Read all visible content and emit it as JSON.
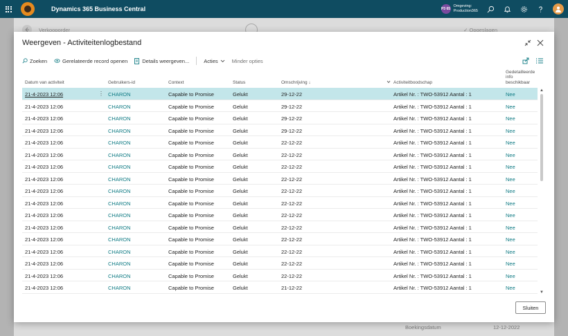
{
  "app": {
    "title": "Dynamics 365 Business Central",
    "environment": {
      "badge": "P3 65",
      "label": "Omgeving:",
      "name": "Production365"
    }
  },
  "background_page": {
    "title": "Verkooporder",
    "saved_status": "✓ Opgeslagen",
    "footer_label": "Boekingsdatum",
    "footer_value": "12-12-2022"
  },
  "dialog": {
    "title": "Weergeven - Activiteitenlogbestand",
    "actions": {
      "search": "Zoeken",
      "open_related": "Gerelateerde record openen",
      "show_details": "Details weergeven...",
      "actions_menu": "Acties",
      "fewer_options": "Minder opties"
    },
    "columns": {
      "date": "Datum van activiteit",
      "user_id": "Gebruikers-id",
      "context": "Context",
      "status": "Status",
      "description": "Omschrijving ↓",
      "message": "Activiteitboodschap",
      "detailed": "Gedetailleerde info beschikbaar"
    },
    "rows": [
      {
        "date": "21-4-2023 12:06",
        "user": "CHARON",
        "context": "Capable to Promise",
        "status": "Gelukt",
        "description": "29-12-22",
        "message": "Artikel Nr. : TWO-53912 Aantal : 1",
        "detailed": "Nee"
      },
      {
        "date": "21-4-2023 12:06",
        "user": "CHARON",
        "context": "Capable to Promise",
        "status": "Gelukt",
        "description": "29-12-22",
        "message": "Artikel Nr. : TWO-53912 Aantal : 1",
        "detailed": "Nee"
      },
      {
        "date": "21-4-2023 12:06",
        "user": "CHARON",
        "context": "Capable to Promise",
        "status": "Gelukt",
        "description": "29-12-22",
        "message": "Artikel Nr. : TWO-53912 Aantal : 1",
        "detailed": "Nee"
      },
      {
        "date": "21-4-2023 12:06",
        "user": "CHARON",
        "context": "Capable to Promise",
        "status": "Gelukt",
        "description": "29-12-22",
        "message": "Artikel Nr. : TWO-53912 Aantal : 1",
        "detailed": "Nee"
      },
      {
        "date": "21-4-2023 12:06",
        "user": "CHARON",
        "context": "Capable to Promise",
        "status": "Gelukt",
        "description": "22-12-22",
        "message": "Artikel Nr. : TWO-53912 Aantal : 1",
        "detailed": "Nee"
      },
      {
        "date": "21-4-2023 12:06",
        "user": "CHARON",
        "context": "Capable to Promise",
        "status": "Gelukt",
        "description": "22-12-22",
        "message": "Artikel Nr. : TWO-53912 Aantal : 1",
        "detailed": "Nee"
      },
      {
        "date": "21-4-2023 12:06",
        "user": "CHARON",
        "context": "Capable to Promise",
        "status": "Gelukt",
        "description": "22-12-22",
        "message": "Artikel Nr. : TWO-53912 Aantal : 1",
        "detailed": "Nee"
      },
      {
        "date": "21-4-2023 12:06",
        "user": "CHARON",
        "context": "Capable to Promise",
        "status": "Gelukt",
        "description": "22-12-22",
        "message": "Artikel Nr. : TWO-53912 Aantal : 1",
        "detailed": "Nee"
      },
      {
        "date": "21-4-2023 12:06",
        "user": "CHARON",
        "context": "Capable to Promise",
        "status": "Gelukt",
        "description": "22-12-22",
        "message": "Artikel Nr. : TWO-53912 Aantal : 1",
        "detailed": "Nee"
      },
      {
        "date": "21-4-2023 12:06",
        "user": "CHARON",
        "context": "Capable to Promise",
        "status": "Gelukt",
        "description": "22-12-22",
        "message": "Artikel Nr. : TWO-53912 Aantal : 1",
        "detailed": "Nee"
      },
      {
        "date": "21-4-2023 12:06",
        "user": "CHARON",
        "context": "Capable to Promise",
        "status": "Gelukt",
        "description": "22-12-22",
        "message": "Artikel Nr. : TWO-53912 Aantal : 1",
        "detailed": "Nee"
      },
      {
        "date": "21-4-2023 12:06",
        "user": "CHARON",
        "context": "Capable to Promise",
        "status": "Gelukt",
        "description": "22-12-22",
        "message": "Artikel Nr. : TWO-53912 Aantal : 1",
        "detailed": "Nee"
      },
      {
        "date": "21-4-2023 12:06",
        "user": "CHARON",
        "context": "Capable to Promise",
        "status": "Gelukt",
        "description": "22-12-22",
        "message": "Artikel Nr. : TWO-53912 Aantal : 1",
        "detailed": "Nee"
      },
      {
        "date": "21-4-2023 12:06",
        "user": "CHARON",
        "context": "Capable to Promise",
        "status": "Gelukt",
        "description": "22-12-22",
        "message": "Artikel Nr. : TWO-53912 Aantal : 1",
        "detailed": "Nee"
      },
      {
        "date": "21-4-2023 12:06",
        "user": "CHARON",
        "context": "Capable to Promise",
        "status": "Gelukt",
        "description": "22-12-22",
        "message": "Artikel Nr. : TWO-53912 Aantal : 1",
        "detailed": "Nee"
      },
      {
        "date": "21-4-2023 12:06",
        "user": "CHARON",
        "context": "Capable to Promise",
        "status": "Gelukt",
        "description": "22-12-22",
        "message": "Artikel Nr. : TWO-53912 Aantal : 1",
        "detailed": "Nee"
      },
      {
        "date": "21-4-2023 12:06",
        "user": "CHARON",
        "context": "Capable to Promise",
        "status": "Gelukt",
        "description": "21-12-22",
        "message": "Artikel Nr. : TWO-53912 Aantal : 1",
        "detailed": "Nee"
      }
    ],
    "selected_row": 0,
    "close_label": "Sluiten"
  },
  "colors": {
    "appbar": "#0f4c61",
    "link": "#0e7a83",
    "selected_row": "#c3e6ea"
  },
  "icons": [
    "waffle-icon",
    "search-icon",
    "bell-icon",
    "gear-icon",
    "help-icon",
    "collapse-icon",
    "close-icon",
    "share-icon",
    "list-icon",
    "open-related-icon",
    "details-icon",
    "chevron-down-icon",
    "more-icon"
  ]
}
